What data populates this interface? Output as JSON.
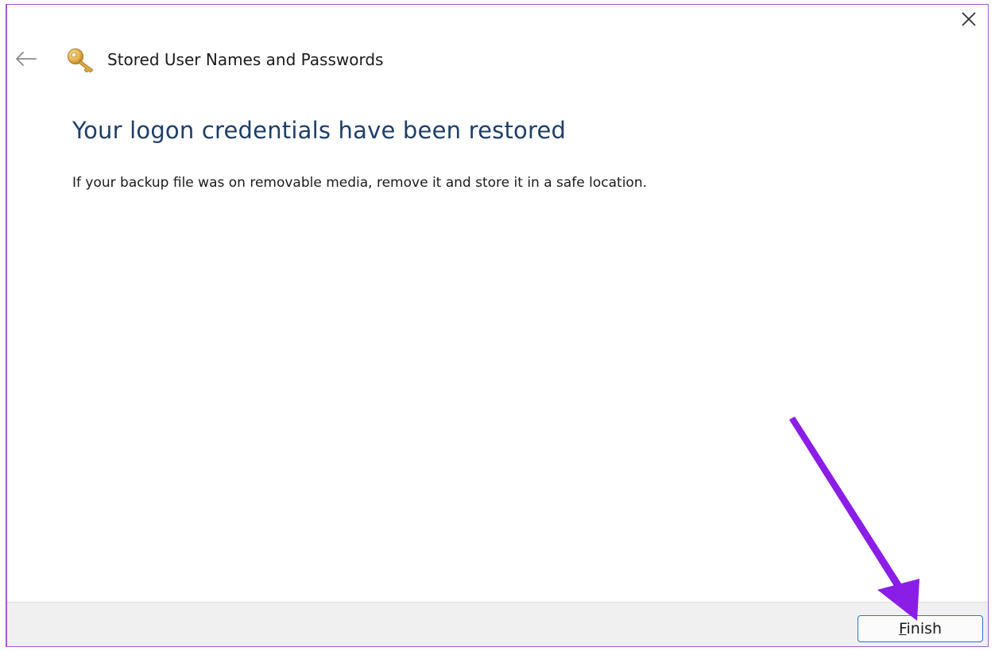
{
  "window": {
    "title": "Stored User Names and Passwords",
    "close_icon": "close-icon",
    "back_icon": "back-arrow-icon",
    "app_icon": "key-icon"
  },
  "content": {
    "heading": "Your logon credentials have been restored",
    "message": "If your backup file was on removable media, remove it and store it in a safe location."
  },
  "footer": {
    "finish_mnemonic": "F",
    "finish_rest": "inish"
  },
  "colors": {
    "heading": "#1e3f66",
    "window_border": "#a259c9",
    "annotation_arrow": "#8a1ee6",
    "button_border": "#2a73c8"
  }
}
